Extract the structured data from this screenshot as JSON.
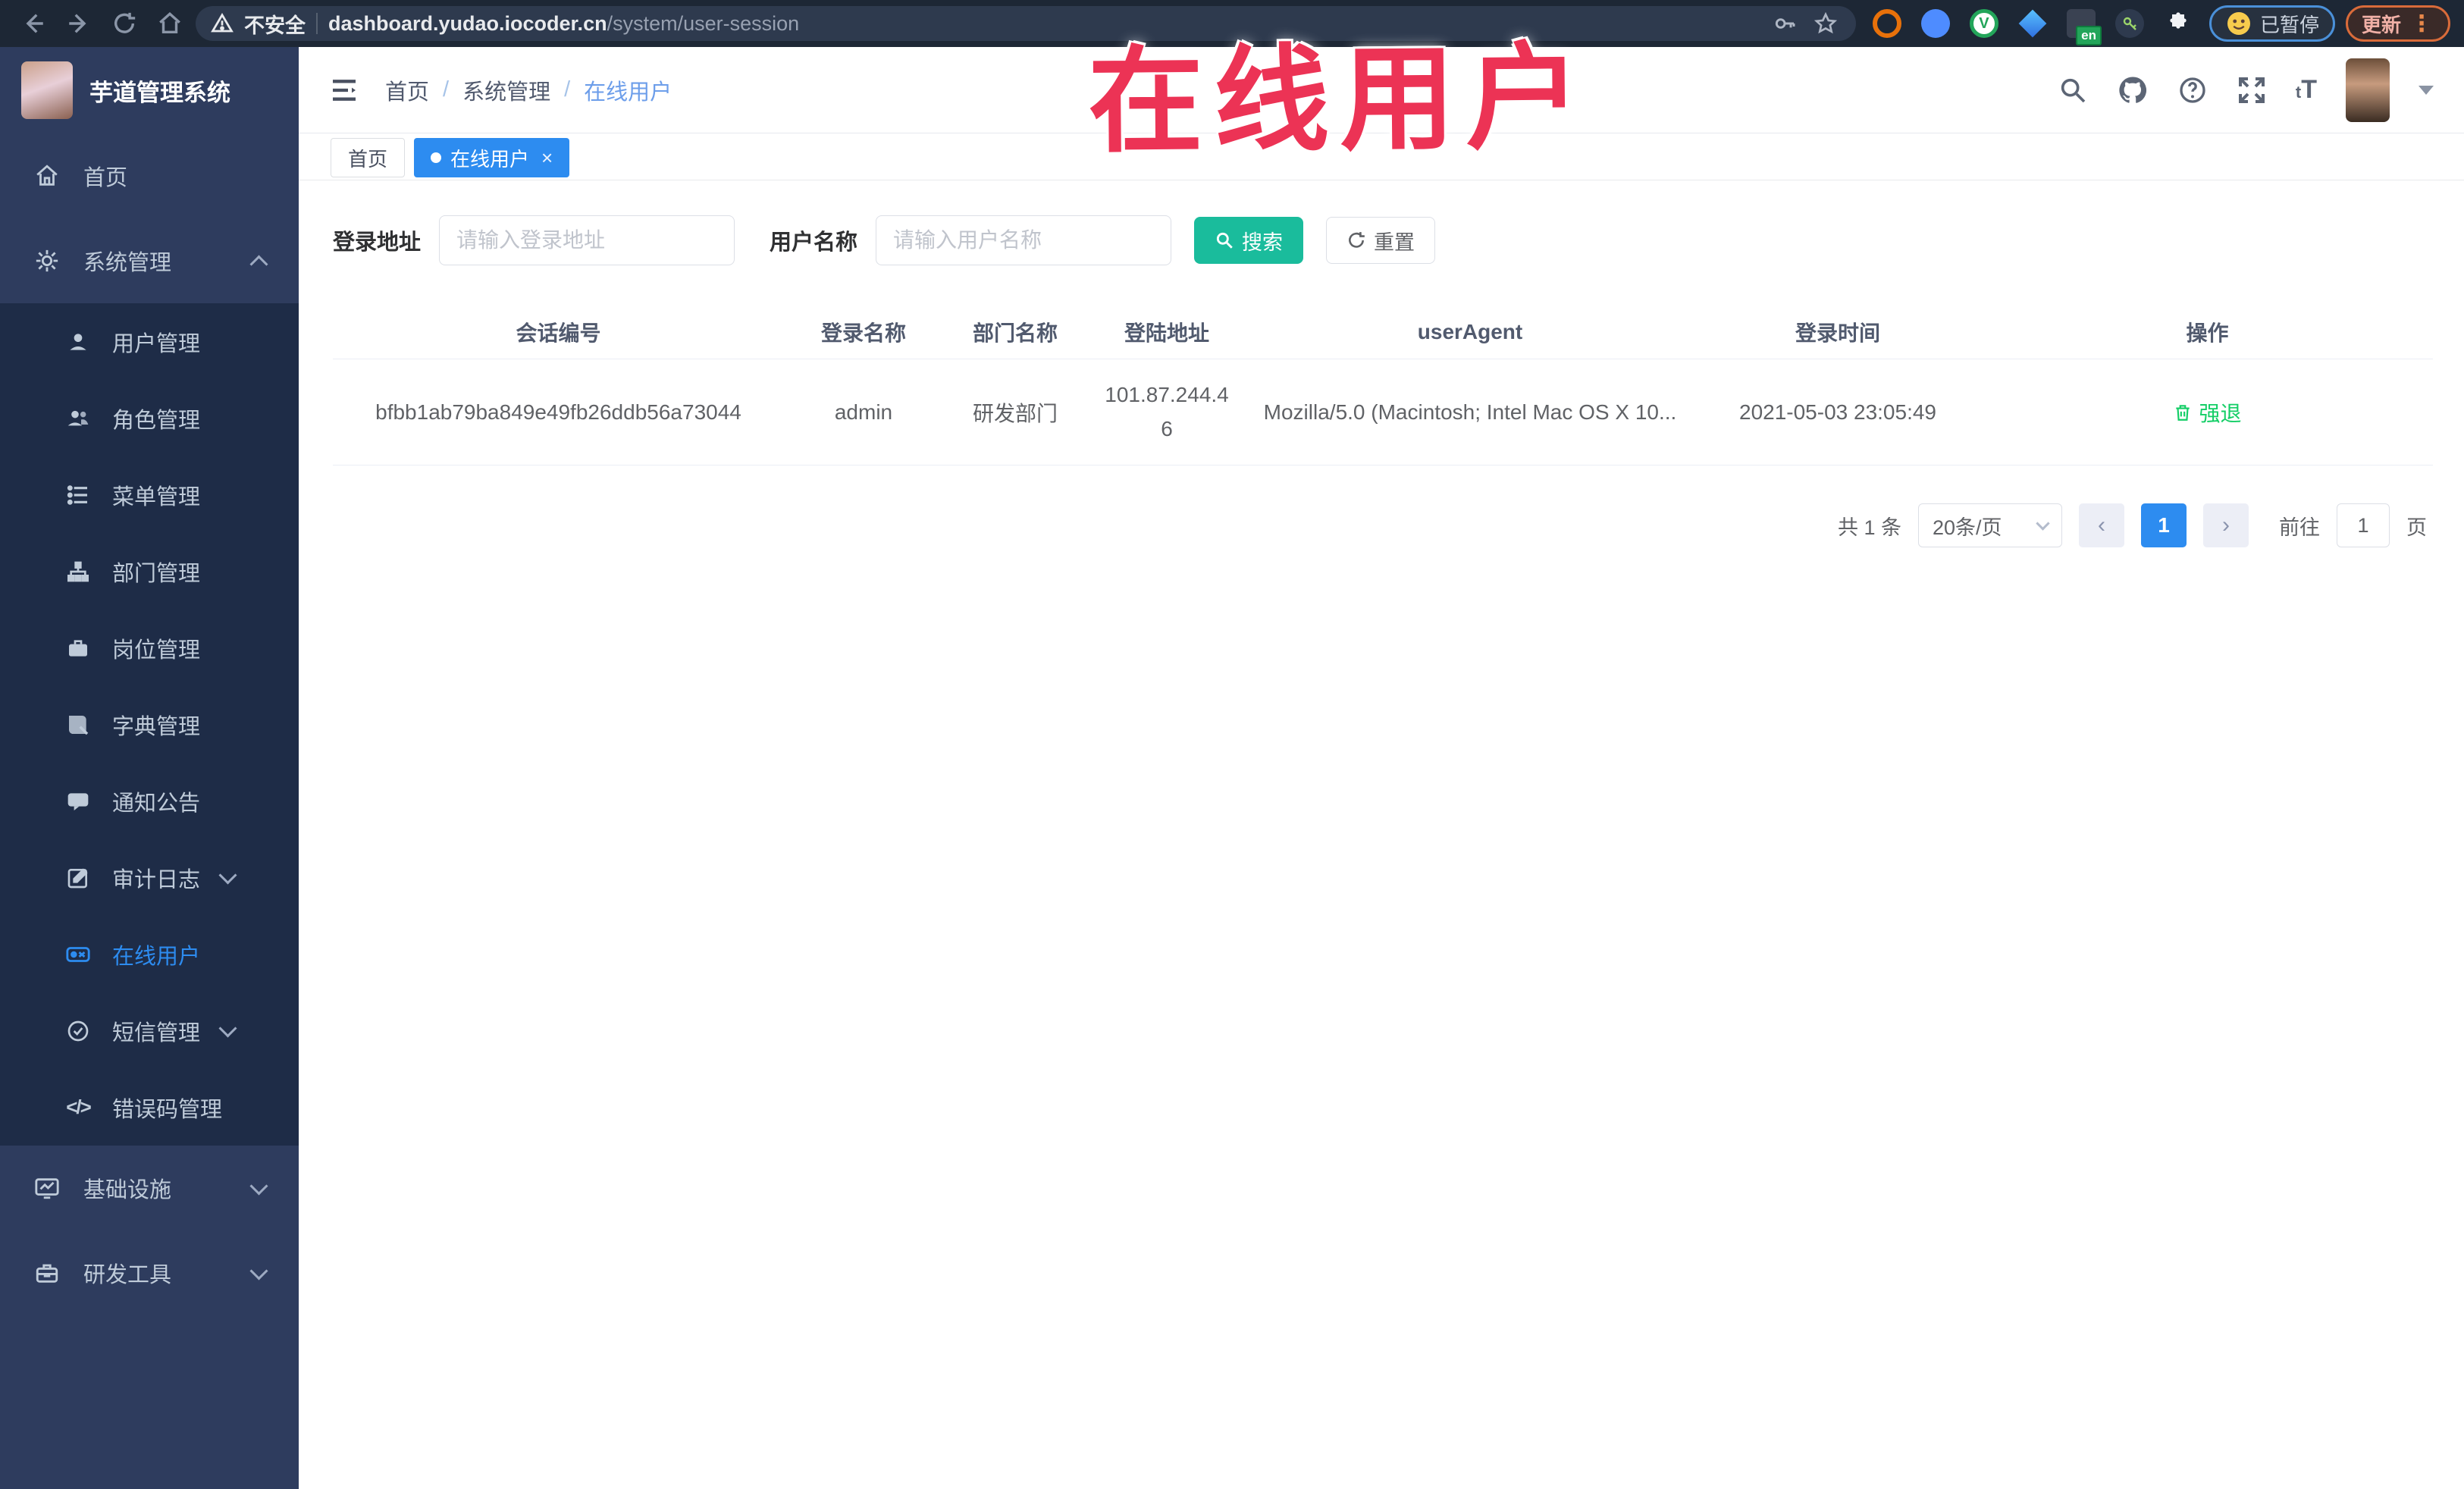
{
  "browser": {
    "not_secure": "不安全",
    "host": "dashboard.yudao.iocoder.cn",
    "path": "/system/user-session",
    "en_badge": "en",
    "paused": "已暂停",
    "update": "更新",
    "menu_dots": "⋮"
  },
  "annotation": {
    "text": "在线用户",
    "color": "#ec3355"
  },
  "header": {
    "logo_title": "芋道管理系统",
    "breadcrumb": {
      "home": "首页",
      "section": "系统管理",
      "current": "在线用户"
    },
    "font_size_icon": "tT"
  },
  "tabs": {
    "home": "首页",
    "active": "在线用户",
    "close": "×"
  },
  "sidebar": {
    "home": "首页",
    "system": "系统管理",
    "items": [
      {
        "label": "用户管理"
      },
      {
        "label": "角色管理"
      },
      {
        "label": "菜单管理"
      },
      {
        "label": "部门管理"
      },
      {
        "label": "岗位管理"
      },
      {
        "label": "字典管理"
      },
      {
        "label": "通知公告"
      },
      {
        "label": "审计日志"
      },
      {
        "label": "在线用户"
      },
      {
        "label": "短信管理"
      },
      {
        "label": "错误码管理"
      }
    ],
    "infra": "基础设施",
    "devtools": "研发工具",
    "code_glyph": "</>"
  },
  "filters": {
    "addr_label": "登录地址",
    "addr_placeholder": "请输入登录地址",
    "name_label": "用户名称",
    "name_placeholder": "请输入用户名称",
    "search": "搜索",
    "reset": "重置"
  },
  "table": {
    "columns": [
      "会话编号",
      "登录名称",
      "部门名称",
      "登陆地址",
      "userAgent",
      "登录时间",
      "操作"
    ],
    "row": {
      "session_id": "bfbb1ab79ba849e49fb26ddb56a73044",
      "username": "admin",
      "dept": "研发部门",
      "ip": "101.87.244.46",
      "user_agent": "Mozilla/5.0 (Macintosh; Intel Mac OS X 10...",
      "login_time": "2021-05-03 23:05:49",
      "action": "强退"
    }
  },
  "pagination": {
    "total": "共 1 条",
    "page_size": "20条/页",
    "page": "1",
    "goto_label": "前往",
    "goto_value": "1",
    "page_unit": "页"
  },
  "colors": {
    "primary": "#2d8cf0",
    "teal": "#1abc9c",
    "success": "#13ce66",
    "annotation_red": "#ec3355"
  }
}
